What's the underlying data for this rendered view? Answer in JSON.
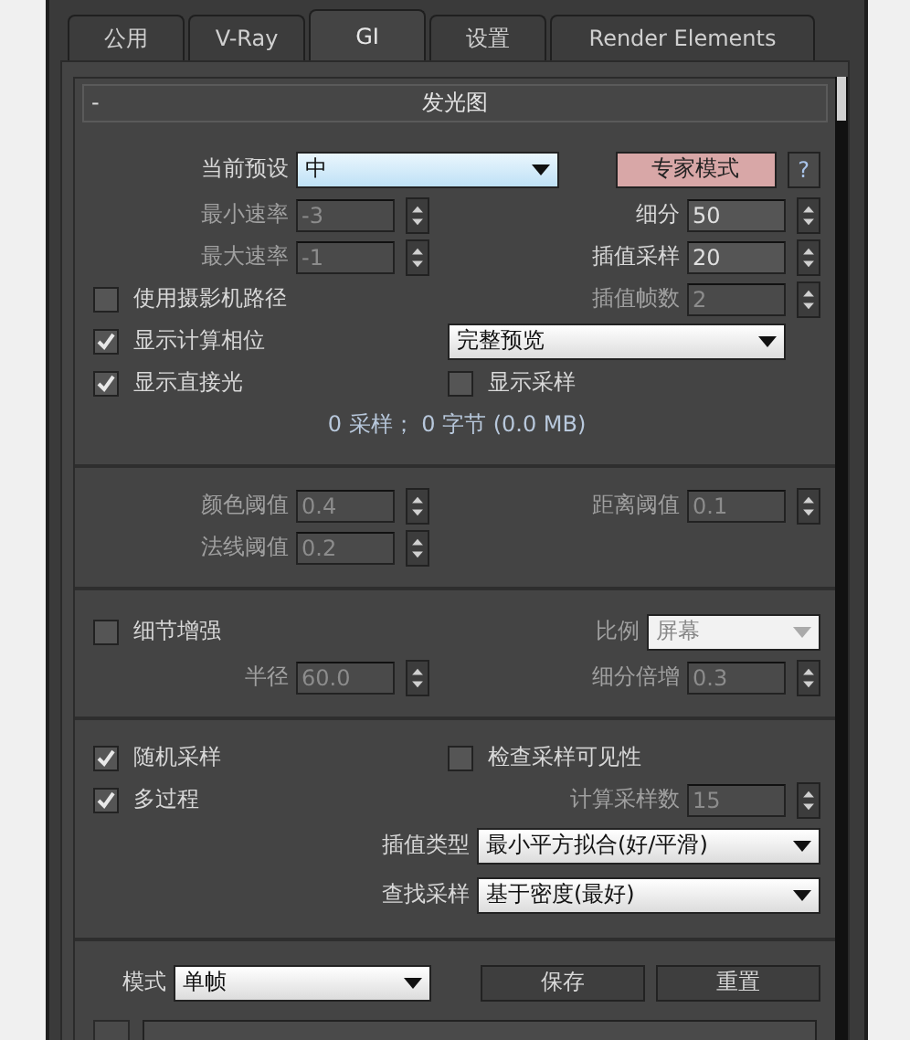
{
  "tabs": [
    {
      "label": "公用",
      "selected": false
    },
    {
      "label": "V-Ray",
      "selected": false
    },
    {
      "label": "GI",
      "selected": true
    },
    {
      "label": "设置",
      "selected": false
    },
    {
      "label": "Render Elements",
      "selected": false
    }
  ],
  "rollout": {
    "collapse": "-",
    "title": "发光图"
  },
  "sections": [
    {
      "rows": [
        {
          "left": [
            {
              "kind": "dropdown",
              "label": "当前预设",
              "value": "中",
              "focused": true,
              "disabled": false
            }
          ],
          "right": [
            {
              "kind": "button",
              "label": "专家模式",
              "active": true
            },
            {
              "kind": "button",
              "label": "?",
              "active": false
            }
          ]
        },
        {
          "left": [
            {
              "kind": "spinner",
              "label": "最小速率",
              "value": "-3",
              "disabled": true
            }
          ],
          "right": [
            {
              "kind": "spinner",
              "label": "细分",
              "value": "50",
              "disabled": false
            }
          ]
        },
        {
          "left": [
            {
              "kind": "spinner",
              "label": "最大速率",
              "value": "-1",
              "disabled": true
            }
          ],
          "right": [
            {
              "kind": "spinner",
              "label": "插值采样",
              "value": "20",
              "disabled": false
            }
          ]
        },
        {
          "left": [
            {
              "kind": "checkbox",
              "label": "使用摄影机路径",
              "checked": false
            }
          ],
          "right": [
            {
              "kind": "spinner",
              "label": "插值帧数",
              "value": "2",
              "disabled": true
            }
          ]
        },
        {
          "left": [
            {
              "kind": "checkbox",
              "label": "显示计算相位",
              "checked": true
            }
          ],
          "right": [
            {
              "kind": "dropdown",
              "value": "完整预览",
              "focused": false,
              "disabled": false
            }
          ]
        },
        {
          "left": [
            {
              "kind": "checkbox",
              "label": "显示直接光",
              "checked": true
            }
          ],
          "right": [
            {
              "kind": "checkbox",
              "label": "显示采样",
              "checked": false
            }
          ]
        },
        {
          "text": "0 采样； 0 字节 (0.0 MB)"
        }
      ]
    },
    {
      "rows": [
        {
          "left": [
            {
              "kind": "spinner",
              "label": "颜色阈值",
              "value": "0.4",
              "disabled": true
            }
          ],
          "right": [
            {
              "kind": "spinner",
              "label": "距离阈值",
              "value": "0.1",
              "disabled": true
            }
          ]
        },
        {
          "left": [
            {
              "kind": "spinner",
              "label": "法线阈值",
              "value": "0.2",
              "disabled": true
            }
          ],
          "right": []
        }
      ]
    },
    {
      "rows": [
        {
          "left": [
            {
              "kind": "checkbox",
              "label": "细节增强",
              "checked": false
            }
          ],
          "right": [
            {
              "kind": "dropdown",
              "label": "比例",
              "value": "屏幕",
              "focused": false,
              "disabled": true
            }
          ]
        },
        {
          "left": [
            {
              "kind": "spinner",
              "label": "半径",
              "value": "60.0",
              "disabled": true
            }
          ],
          "right": [
            {
              "kind": "spinner",
              "label": "细分倍增",
              "value": "0.3",
              "disabled": true
            }
          ]
        }
      ]
    },
    {
      "rows": [
        {
          "left": [
            {
              "kind": "checkbox",
              "label": "随机采样",
              "checked": true
            }
          ],
          "right": [
            {
              "kind": "checkbox",
              "label": "检查采样可见性",
              "checked": false
            }
          ]
        },
        {
          "left": [
            {
              "kind": "checkbox",
              "label": "多过程",
              "checked": true
            }
          ],
          "right": [
            {
              "kind": "spinner",
              "label": "计算采样数",
              "value": "15",
              "disabled": true
            }
          ]
        },
        {
          "left": [],
          "right": [
            {
              "kind": "dropdown",
              "label": "插值类型",
              "value": "最小平方拟合(好/平滑)",
              "focused": false,
              "disabled": false
            }
          ]
        },
        {
          "left": [],
          "right": [
            {
              "kind": "dropdown",
              "label": "查找采样",
              "value": "基于密度(最好)",
              "focused": false,
              "disabled": false
            }
          ]
        }
      ]
    },
    {
      "rows": [
        {
          "left": [
            {
              "kind": "dropdown",
              "label": "模式",
              "value": "单帧",
              "focused": false,
              "disabled": false
            }
          ],
          "right": [
            {
              "kind": "button",
              "label": "保存",
              "active": false
            },
            {
              "kind": "button",
              "label": "重置",
              "active": false
            }
          ]
        },
        {
          "kind": "file"
        }
      ]
    }
  ]
}
